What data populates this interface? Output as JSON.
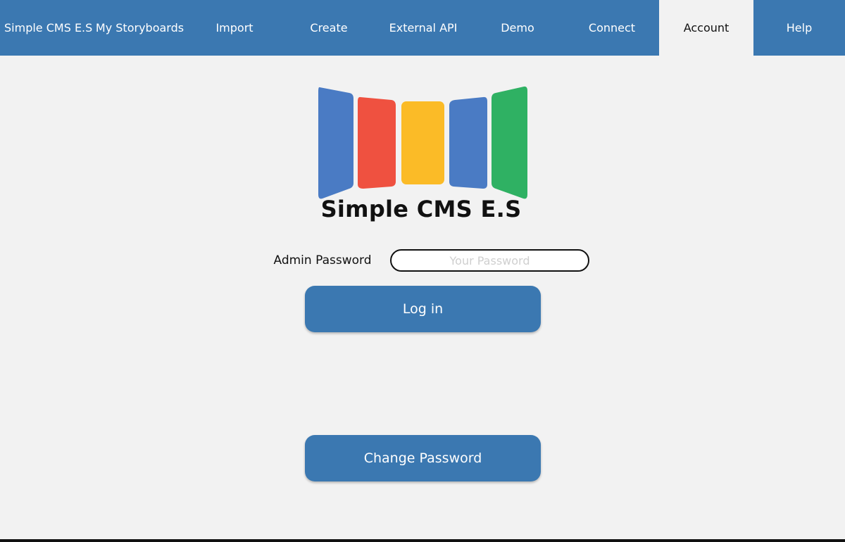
{
  "nav": {
    "brand": "Simple CMS E.S",
    "items": [
      {
        "label": "My Storyboards"
      },
      {
        "label": "Import"
      },
      {
        "label": "Create"
      },
      {
        "label": "External API"
      },
      {
        "label": "Demo"
      },
      {
        "label": "Connect"
      },
      {
        "label": "Account"
      },
      {
        "label": "Help"
      }
    ],
    "active": "Account",
    "bar_color": "#3b78b1"
  },
  "logo": {
    "title": "Simple CMS E.S",
    "panel_colors": [
      "#4a7bc4",
      "#ef5140",
      "#fbbb27",
      "#4a7bc4",
      "#2fb163"
    ]
  },
  "login": {
    "password_label": "Admin Password",
    "password_placeholder": "Your Password",
    "password_value": "",
    "login_button": "Log in",
    "change_password_button": "Change Password"
  }
}
